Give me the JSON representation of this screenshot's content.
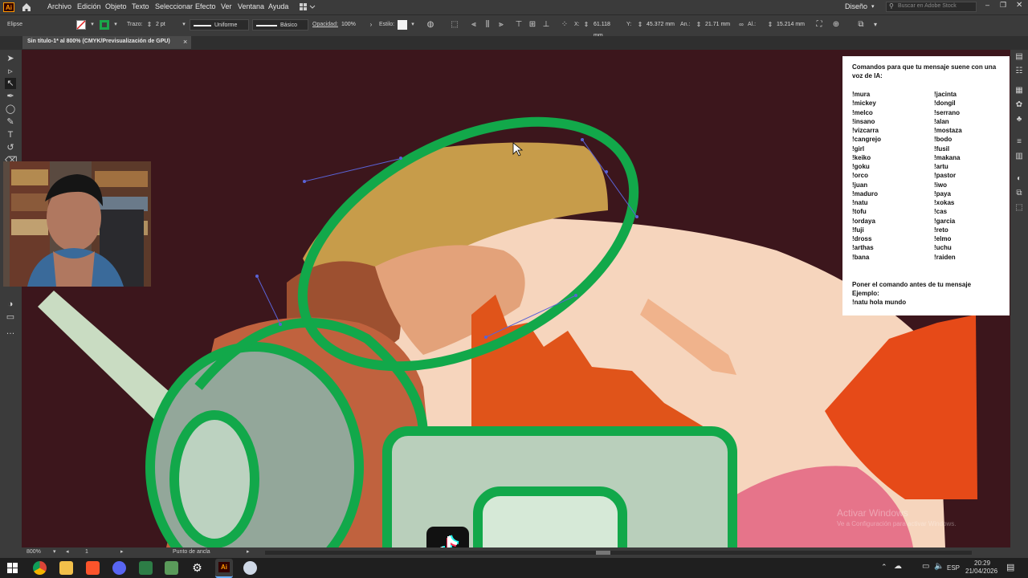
{
  "app": {
    "logo": "Ai",
    "menu": [
      "Archivo",
      "Edición",
      "Objeto",
      "Texto",
      "Seleccionar",
      "Efecto",
      "Ver",
      "Ventana",
      "Ayuda"
    ],
    "workspace": "Diseño",
    "stock_search_placeholder": "Buscar en Adobe Stock"
  },
  "control": {
    "selection_type": "Elipse",
    "stroke_label": "Trazo:",
    "stroke_width": "2 pt",
    "profile": "Uniforme",
    "brush": "Básico",
    "opacity_label": "Opacidad:",
    "opacity": "100%",
    "style_label": "Estilo:",
    "x_label": "X:",
    "x_value": "61.118 mm",
    "y_label": "Y:",
    "y_value": "45.372 mm",
    "w_label": "An.:",
    "w_value": "21.71 mm",
    "h_label": "Al.:",
    "h_value": "15.214 mm",
    "stroke_color": "#1aa64a"
  },
  "document": {
    "tab_title": "Sin título-1* al 800% (CMYK/Previsualización de GPU)",
    "close": "×"
  },
  "status": {
    "zoom": "800%",
    "artboard": "1",
    "tool_hint": "Punto de ancla"
  },
  "overlay": {
    "title": "Comandos para que tu mensaje suene con una voz de IA:",
    "col1": [
      "!mura",
      "!mickey",
      "!melco",
      "!insano",
      "!vizcarra",
      "!cangrejo",
      "!girl",
      "!keiko",
      "!goku",
      "!orco",
      "!juan",
      "!maduro",
      "!natu",
      "!tofu",
      "!ordaya",
      "!fuji",
      "!dross",
      "!arthas",
      "!bana"
    ],
    "col2": [
      "!jacinta",
      "!dongil",
      "!serrano",
      "!alan",
      "!mostaza",
      "!bodo",
      "!fusil",
      "!makana",
      "!artu",
      "!pastor",
      "!iwo",
      "!paya",
      "!xokas",
      "!cas",
      "!garcia",
      "!reto",
      "!elmo",
      "!uchu",
      "!raiden"
    ],
    "footer1": "Poner el comando antes de tu mensaje",
    "footer2": "Ejemplo:",
    "footer3": "!natu hola mundo"
  },
  "watermark": {
    "line1": "Activar Windows",
    "line2": "Ve a Configuración para activar Windows."
  },
  "taskbar": {
    "lang": "ESP",
    "time": "20:29",
    "date": "21/04/2026"
  }
}
